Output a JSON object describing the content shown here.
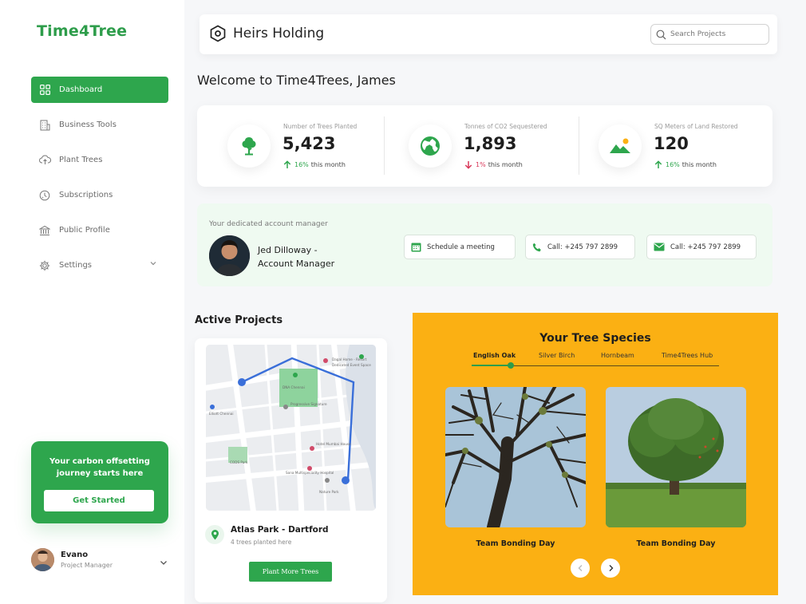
{
  "app": {
    "logo": "Time4Tree"
  },
  "sidebar": {
    "items": [
      {
        "label": "Dashboard",
        "icon": "grid-icon",
        "active": true
      },
      {
        "label": "Business Tools",
        "icon": "building-icon"
      },
      {
        "label": "Plant Trees",
        "icon": "cloud-upload-icon"
      },
      {
        "label": "Subscriptions",
        "icon": "clock-refresh-icon"
      },
      {
        "label": "Public Profile",
        "icon": "bank-icon"
      },
      {
        "label": "Settings",
        "icon": "gear-icon"
      }
    ],
    "cta": {
      "text": "Your carbon offsetting journey starts here",
      "button": "Get Started"
    },
    "user": {
      "name": "Evano",
      "role": "Project Manager"
    }
  },
  "header": {
    "company": "Heirs Holding",
    "search_placeholder": "Search Projects"
  },
  "welcome": "Welcome to Time4Trees, James",
  "stats": [
    {
      "label": "Number of Trees Planted",
      "value": "5,423",
      "change": "16%",
      "direction": "up",
      "suffix": "this month",
      "icon": "tree-icon"
    },
    {
      "label": "Tonnes of CO2 Sequestered",
      "value": "1,893",
      "change": "1%",
      "direction": "down",
      "suffix": "this month",
      "icon": "globe-icon"
    },
    {
      "label": "SQ Meters of Land Restored",
      "value": "120",
      "change": "16%",
      "direction": "up",
      "suffix": "this month",
      "icon": "landscape-icon"
    }
  ],
  "manager": {
    "title": "Your dedicated account manager",
    "name": "Jed Dilloway - Account Manager",
    "buttons": [
      {
        "label": "Schedule a meeting",
        "icon": "calendar-icon"
      },
      {
        "label": "Call: +245 797 2899",
        "icon": "phone-icon"
      },
      {
        "label": "Call: +245 797 2899",
        "icon": "mail-icon"
      }
    ]
  },
  "projects": {
    "title": "Active Projects",
    "name": "Atlas Park - Dartford",
    "sub": "4 trees planted here",
    "button": "Plant More Trees",
    "map_labels": [
      "Dagal Home - Resort",
      "Dedicated Event Space",
      "DNA Chennai",
      "Progressive Signature",
      "Hotel Mumbai House",
      "Sona Multispeciality Hospital",
      "CODS Park",
      "Elliott Chennai",
      "Nature Park"
    ]
  },
  "species": {
    "title": "Your Tree Species",
    "tabs": [
      "English Oak",
      "Silver Birch",
      "Hornbeam",
      "Time4Trees Hub"
    ],
    "active_tab": 0,
    "cards": [
      {
        "caption": "Team Bonding Day"
      },
      {
        "caption": "Team Bonding Day"
      }
    ]
  },
  "colors": {
    "brand": "#2ea64d",
    "accent": "#fbb013",
    "down": "#d9385a"
  }
}
